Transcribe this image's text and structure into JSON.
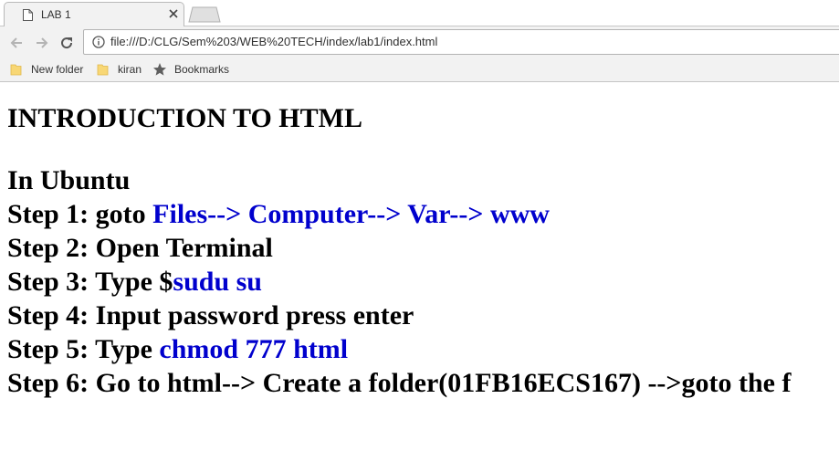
{
  "browser": {
    "tab_title": "LAB 1",
    "url": "file:///D:/CLG/Sem%203/WEB%20TECH/index/lab1/index.html",
    "bookmarks": [
      {
        "label": "New folder",
        "icon": "folder-icon"
      },
      {
        "label": "kiran",
        "icon": "folder-icon"
      },
      {
        "label": "Bookmarks",
        "icon": "star-icon"
      }
    ]
  },
  "page": {
    "heading": "INTRODUCTION TO HTML",
    "subheading": "In Ubuntu",
    "steps": [
      {
        "prefix": "Step 1: goto ",
        "highlight": "Files--> Computer--> Var--> www",
        "suffix": ""
      },
      {
        "prefix": "Step 2: Open Terminal",
        "highlight": "",
        "suffix": ""
      },
      {
        "prefix": "Step 3: Type $",
        "highlight": "sudu su",
        "suffix": ""
      },
      {
        "prefix": "Step 4: Input password press enter",
        "highlight": "",
        "suffix": ""
      },
      {
        "prefix": "Step 5: Type ",
        "highlight": "chmod 777 html",
        "suffix": ""
      },
      {
        "prefix": "Step 6: Go to html--> Create a folder(01FB16ECS167) -->goto the f",
        "highlight": "",
        "suffix": ""
      }
    ]
  },
  "colors": {
    "highlight": "#0000cd",
    "text": "#000000",
    "chrome_bg": "#f2f2f2"
  }
}
